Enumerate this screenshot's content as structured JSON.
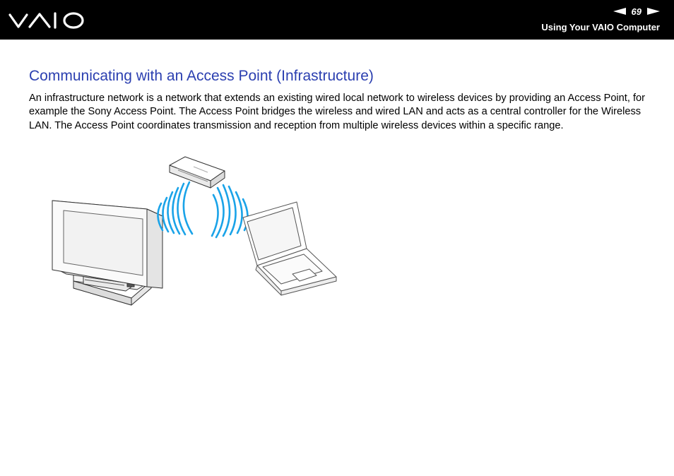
{
  "header": {
    "logo": "VAIO",
    "page_number": "69",
    "section_title": "Using Your VAIO Computer",
    "prev_icon": "arrow-left-icon",
    "next_icon": "arrow-right-icon"
  },
  "content": {
    "heading": "Communicating with an Access Point (Infrastructure)",
    "paragraph": "An infrastructure network is a network that extends an existing wired local network to wireless devices by providing an Access Point, for example the Sony Access Point. The Access Point bridges the wireless and wired LAN and acts as a central controller for the Wireless LAN. The Access Point coordinates transmission and reception from multiple wireless devices within a specific range."
  },
  "illustration": {
    "devices": [
      "desktop-monitor",
      "access-point",
      "laptop"
    ],
    "wave_color": "#1aa3e8"
  },
  "colors": {
    "header_bg": "#000000",
    "heading": "#2b3fb0",
    "wave": "#1aa3e8"
  }
}
